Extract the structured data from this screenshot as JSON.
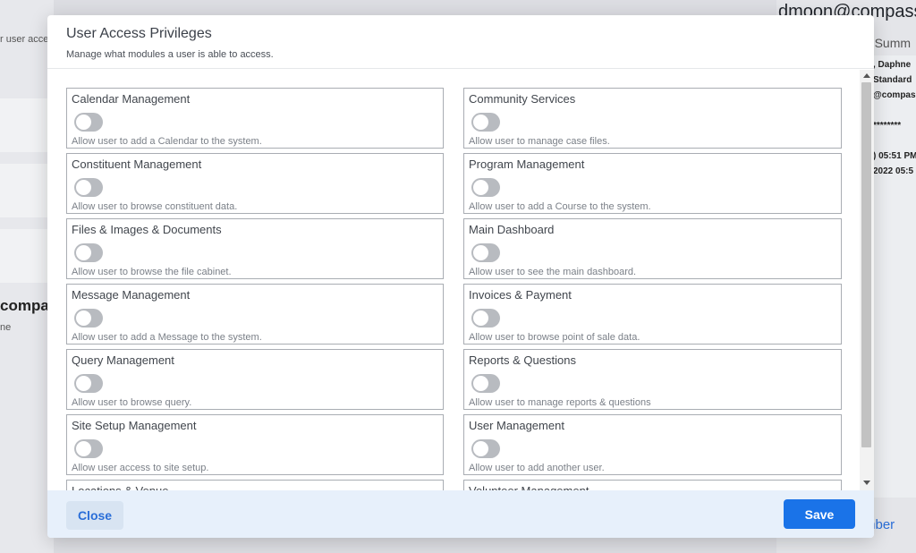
{
  "background": {
    "left_text": "r user acce",
    "left_bold": "compass",
    "left_sub": "ne",
    "right_title": "dmoon@compass",
    "right_subtitle": "nt Summ",
    "right_lines": ", Daphne|Standard|@compas|********|) 05:51 PM|2022 05:5",
    "right_button": "mber"
  },
  "modal": {
    "title": "User Access Privileges",
    "subtitle": "Manage what modules a user is able to access.",
    "modules": [
      {
        "title": "Calendar Management",
        "description": "Allow user to add a Calendar to the system.",
        "enabled": false
      },
      {
        "title": "Community Services",
        "description": "Allow user to manage case files.",
        "enabled": false
      },
      {
        "title": "Constituent Management",
        "description": "Allow user to browse constituent data.",
        "enabled": false
      },
      {
        "title": "Program Management",
        "description": "Allow user to add a Course to the system.",
        "enabled": false
      },
      {
        "title": "Files & Images & Documents",
        "description": "Allow user to browse the file cabinet.",
        "enabled": false
      },
      {
        "title": "Main Dashboard",
        "description": "Allow user to see the main dashboard.",
        "enabled": false
      },
      {
        "title": "Message Management",
        "description": "Allow user to add a Message to the system.",
        "enabled": false
      },
      {
        "title": "Invoices & Payment",
        "description": "Allow user to browse point of sale data.",
        "enabled": false
      },
      {
        "title": "Query Management",
        "description": "Allow user to browse query.",
        "enabled": false
      },
      {
        "title": "Reports & Questions",
        "description": "Allow user to manage reports & questions",
        "enabled": false
      },
      {
        "title": "Site Setup Management",
        "description": "Allow user access to site setup.",
        "enabled": false
      },
      {
        "title": "User Management",
        "description": "Allow user to add another user.",
        "enabled": false
      },
      {
        "title": "Locations & Venue",
        "description": "",
        "enabled": false
      },
      {
        "title": "Volunteer Management",
        "description": "",
        "enabled": false
      }
    ],
    "close_label": "Close",
    "save_label": "Save"
  },
  "colors": {
    "primary": "#1a73e8",
    "toggle_off": "#b8bbc0",
    "footer_bg": "#e7f0fb"
  }
}
